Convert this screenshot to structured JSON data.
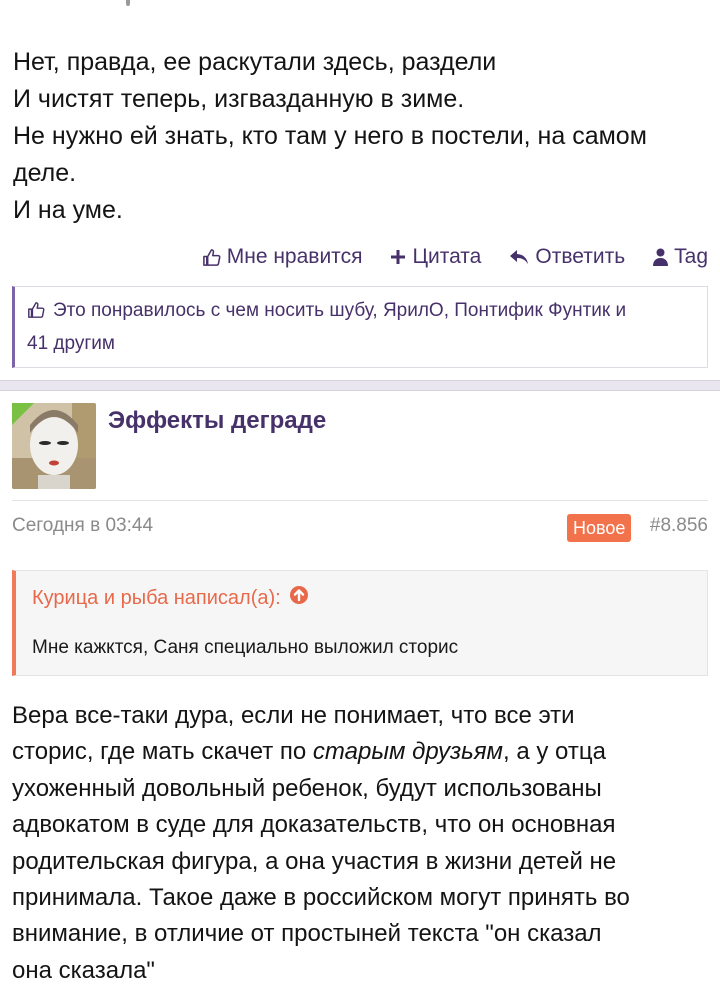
{
  "post1": {
    "lines": [
      "Нет, правда, ее раскутали здесь, раздели",
      "И чистят теперь, изгвазданную в зиме.",
      "Не нужно ей знать, кто там у него в постели, на самом",
      "деле.",
      "И на уме."
    ],
    "actions": {
      "like": "Мне нравится",
      "quote": "Цитата",
      "reply": "Ответить",
      "tag": "Tag"
    },
    "likes": {
      "text_line1": "Это понравилось с чем носить шубу, ЯрилО, Понтифик Фунтик и",
      "text_line2": "41 другим"
    }
  },
  "post2": {
    "author": "Эффекты деграде",
    "date": "Сегодня в 03:44",
    "badge": "Новое",
    "number": "#8.856",
    "quote": {
      "author": "Курица и рыба написал(а):",
      "text": "Мне кажктся, Саня специально выложил сторис"
    },
    "body": {
      "line1": "Вера все-таки дура, если не понимает, что все эти",
      "line2_before": "сторис, где мать скачет по ",
      "line2_italic": "старым друзьям",
      "line2_after": ", а у отца",
      "line3": "ухоженный довольный ребенок, будут использованы",
      "line4": "адвокатом в суде для доказательств, что он основная",
      "line5": "родительская фигура, а она участия в жизни детей не",
      "line6": "принимала. Такое даже в российском могут принять во",
      "line7": "внимание, в отличие от простыней текста \"он сказал",
      "line8": "она сказала\""
    }
  },
  "colors": {
    "accent": "#47316a",
    "quote_accent": "#f07a5a",
    "badge": "#f2734b",
    "online": "#7ac143"
  },
  "icons": [
    "thumbs-up-icon",
    "plus-icon",
    "reply-icon",
    "user-icon",
    "arrow-up-circle-icon"
  ]
}
